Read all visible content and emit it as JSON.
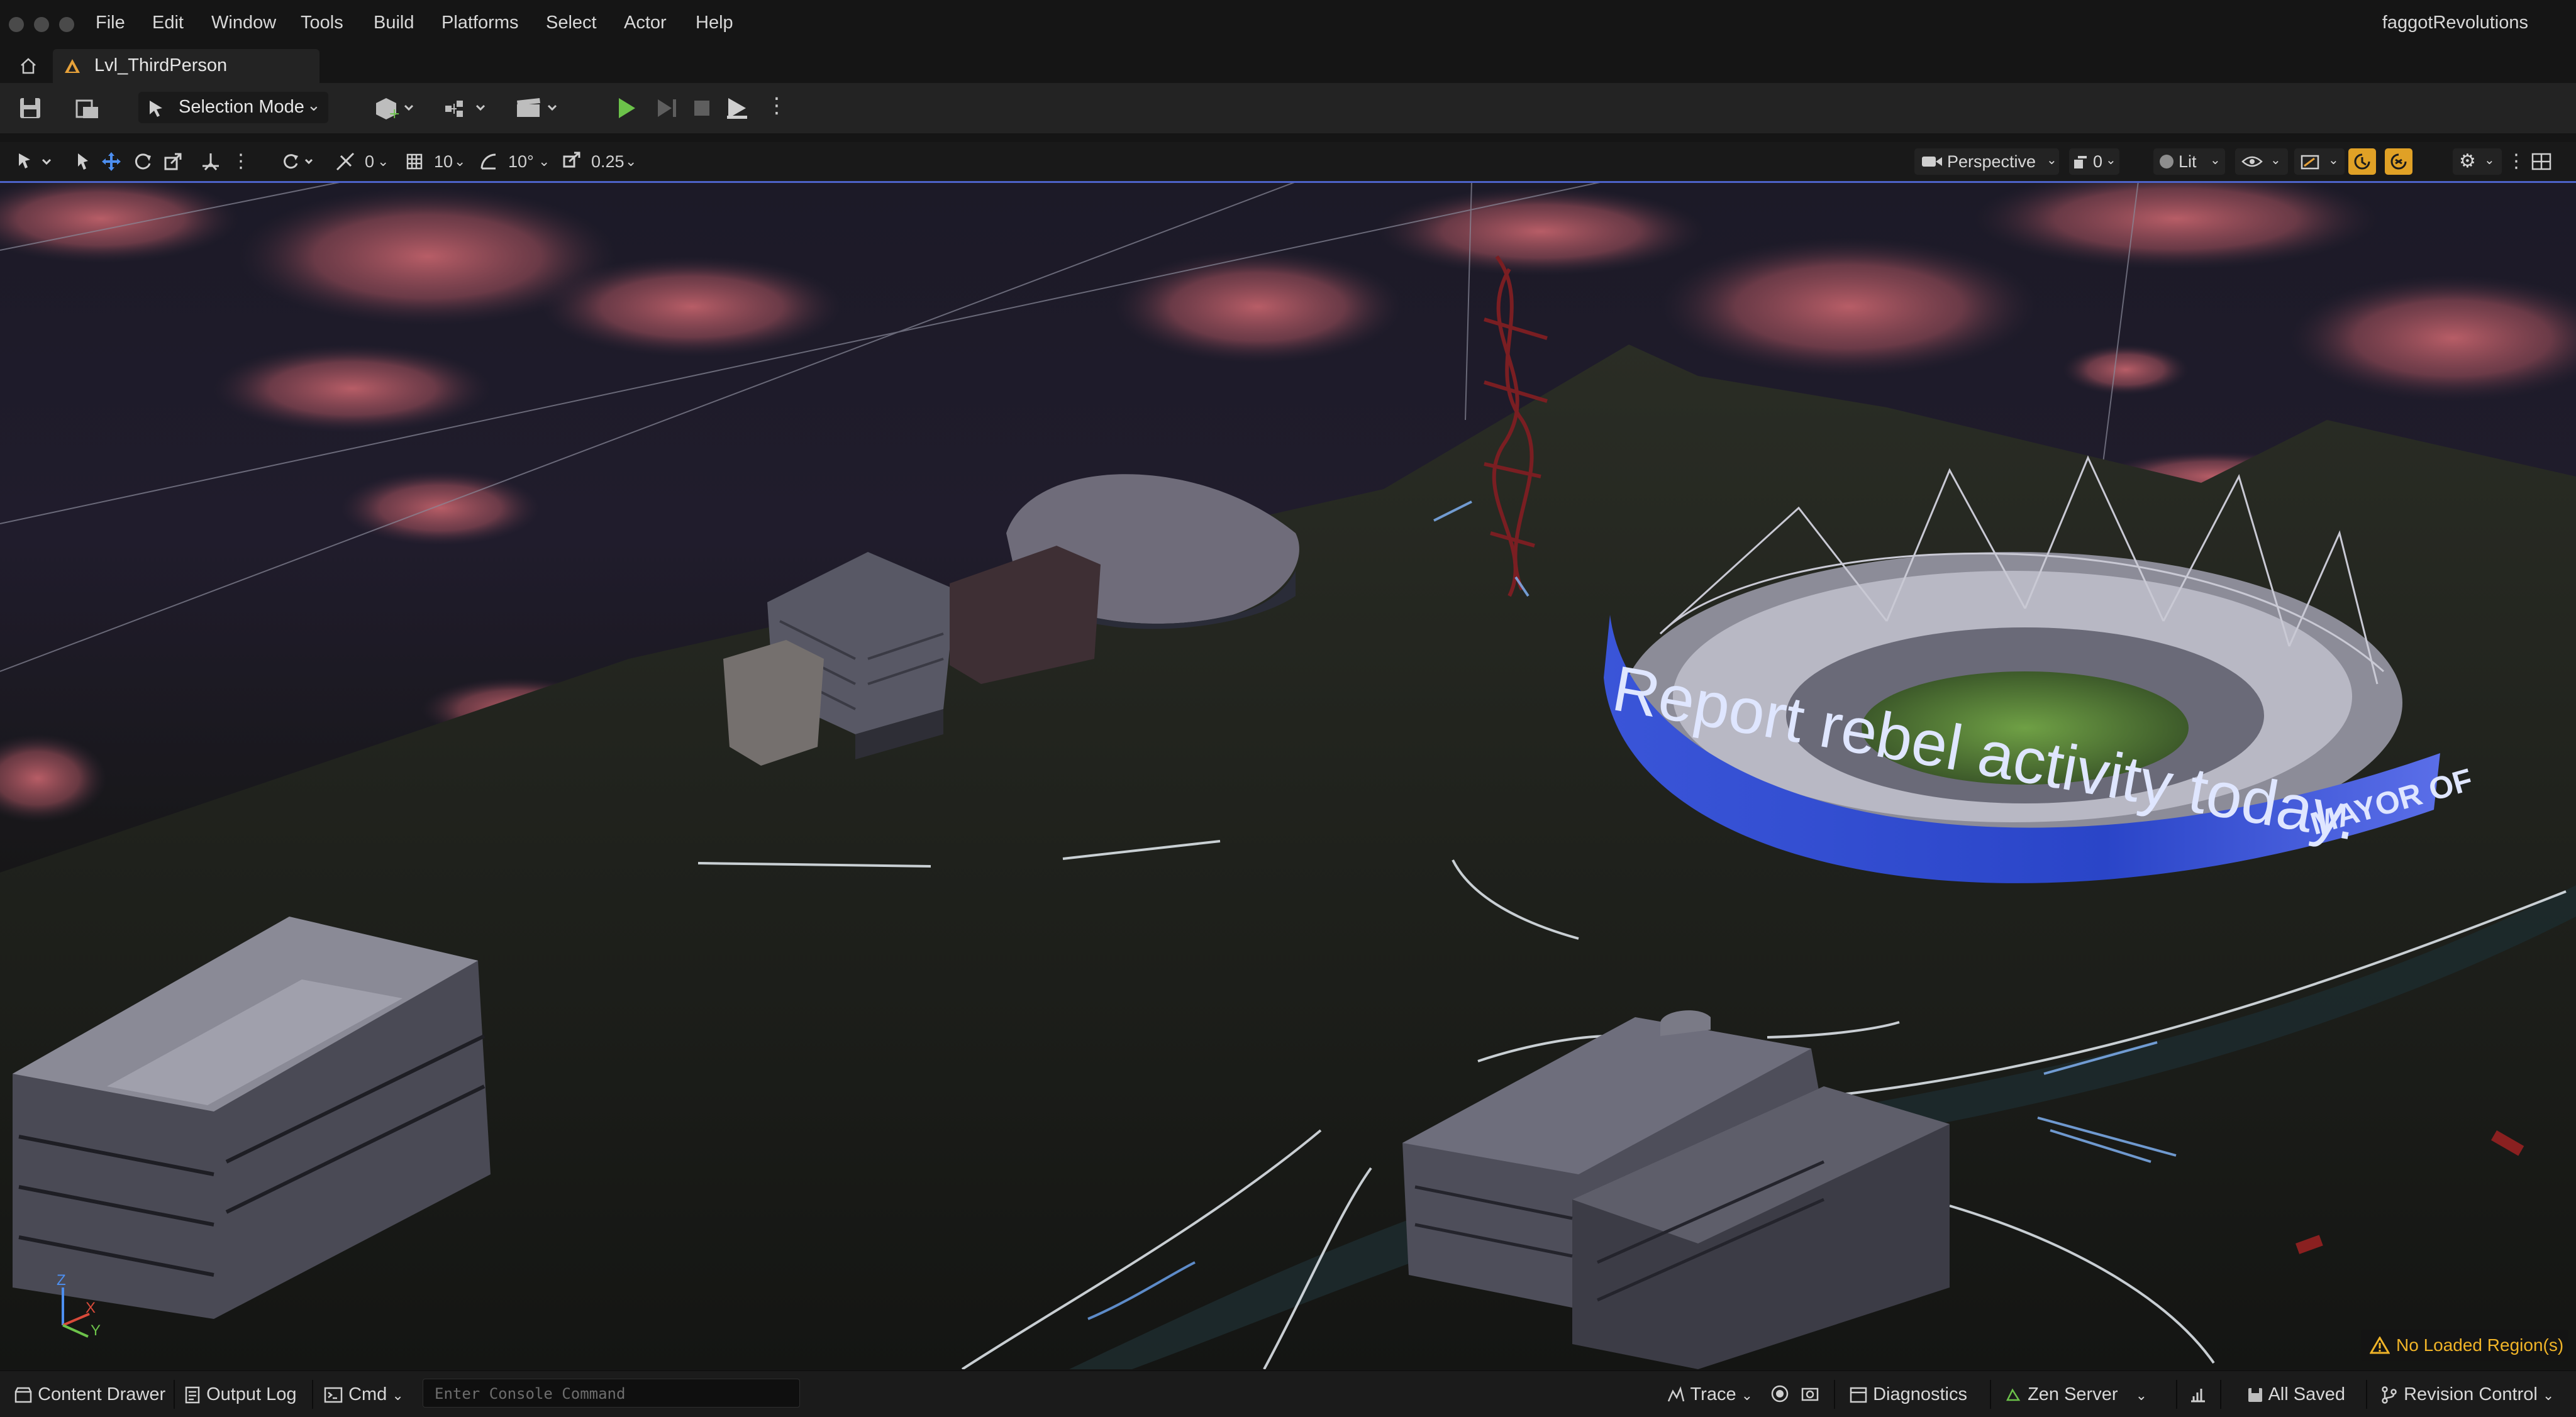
{
  "window": {
    "project_name": "faggotRevolutions"
  },
  "menu": {
    "items": [
      {
        "label": "File"
      },
      {
        "label": "Edit"
      },
      {
        "label": "Window"
      },
      {
        "label": "Tools"
      },
      {
        "label": "Build"
      },
      {
        "label": "Platforms"
      },
      {
        "label": "Select"
      },
      {
        "label": "Actor"
      },
      {
        "label": "Help"
      }
    ]
  },
  "tabs": {
    "level": "Lvl_ThirdPerson"
  },
  "toolbar": {
    "mode_label": "Selection Mode"
  },
  "viewport_toolbar": {
    "translate_snap": "0",
    "grid_snap": "10",
    "rotate_snap": "10°",
    "scale_snap": "0.25",
    "view_mode": "Perspective",
    "camera_speed": "0",
    "lighting": "Lit"
  },
  "scene": {
    "billboard_text": "Report rebel activity today.",
    "billboard_edge_text": "MAYOR OF",
    "axis_z": "Z",
    "axis_x": "X",
    "axis_y": "Y",
    "warning": "No Loaded Region(s)"
  },
  "statusbar": {
    "content_drawer": "Content Drawer",
    "output_log": "Output Log",
    "cmd": "Cmd",
    "console_placeholder": "Enter Console Command",
    "trace": "Trace",
    "diagnostics": "Diagnostics",
    "zen_server": "Zen Server",
    "save_status": "All Saved",
    "revision_control": "Revision Control"
  },
  "colors": {
    "accent_blue": "#4d63c8",
    "play_green": "#6cc24a",
    "warning_amber": "#f0b428",
    "sky_cloud": "#c0616a",
    "billboard_blue": "#2a45c8"
  }
}
